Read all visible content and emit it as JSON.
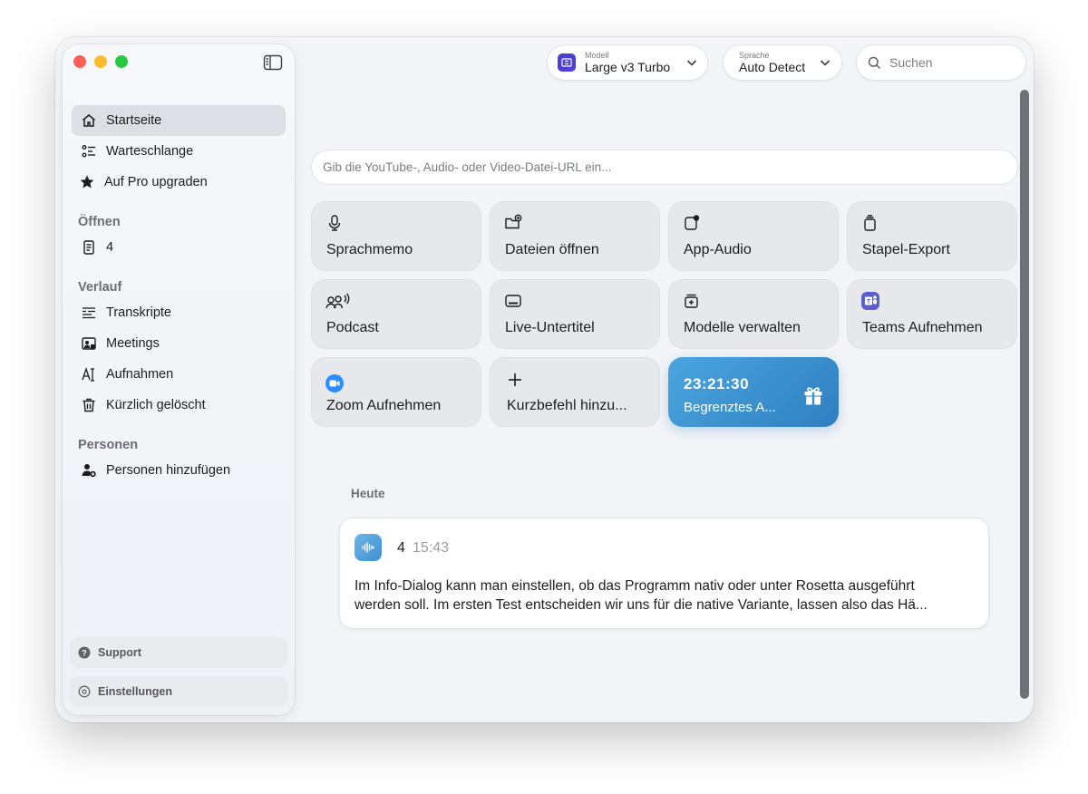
{
  "sidebar": {
    "items": [
      {
        "label": "Startseite",
        "icon": "home-icon",
        "active": true
      },
      {
        "label": "Warteschlange",
        "icon": "queue-list-icon"
      },
      {
        "label": "Auf Pro upgraden",
        "icon": "star-icon"
      }
    ],
    "open_section": {
      "label": "Öffnen",
      "items": [
        {
          "label": "4",
          "icon": "document-icon"
        }
      ]
    },
    "history_section": {
      "label": "Verlauf",
      "items": [
        {
          "label": "Transkripte",
          "icon": "transcript-icon"
        },
        {
          "label": "Meetings",
          "icon": "meetings-icon"
        },
        {
          "label": "Aufnahmen",
          "icon": "recording-text-icon"
        },
        {
          "label": "Kürzlich gelöscht",
          "icon": "trash-icon"
        }
      ]
    },
    "people_section": {
      "label": "Personen",
      "items": [
        {
          "label": "Personen hinzufügen",
          "icon": "add-person-icon"
        }
      ]
    },
    "support": "Support",
    "settings": "Einstellungen"
  },
  "toolbar": {
    "model_caption": "Modell",
    "model_value": "Large v3 Turbo",
    "language_caption": "Sprache",
    "language_value": "Auto Detect",
    "search_placeholder": "Suchen"
  },
  "main": {
    "url_placeholder": "Gib die YouTube-, Audio- oder Video-Datei-URL ein...",
    "tiles": [
      {
        "label": "Sprachmemo",
        "icon": "microphone-icon"
      },
      {
        "label": "Dateien öffnen",
        "icon": "folder-plus-icon"
      },
      {
        "label": "App-Audio",
        "icon": "app-audio-icon"
      },
      {
        "label": "Stapel-Export",
        "icon": "batch-export-icon"
      },
      {
        "label": "Podcast",
        "icon": "podcast-icon"
      },
      {
        "label": "Live-Untertitel",
        "icon": "captions-icon"
      },
      {
        "label": "Modelle verwalten",
        "icon": "manage-models-icon"
      },
      {
        "label": "Teams Aufnehmen",
        "icon": "teams-icon"
      },
      {
        "label": "Zoom Aufnehmen",
        "icon": "zoom-icon"
      },
      {
        "label": "Kurzbefehl hinzu...",
        "icon": "plus-icon"
      }
    ],
    "promo": {
      "timer": "23:21:30",
      "label": "Begrenztes A...",
      "icon": "gift-icon",
      "color": "#3a8fd0"
    },
    "today_label": "Heute",
    "recent": {
      "title": "4",
      "time": "15:43",
      "text_line1": "Im Info-Dialog kann man einstellen, ob das Programm nativ oder unter Rosetta ausgeführt",
      "text_line2": "werden soll. Im ersten Test entscheiden wir uns für die native Variante, lassen also das Hä..."
    }
  },
  "colors": {
    "active_item": "#dcdfe4",
    "tile": "#e6e8ec",
    "model_badge": "#4c3fd6"
  }
}
